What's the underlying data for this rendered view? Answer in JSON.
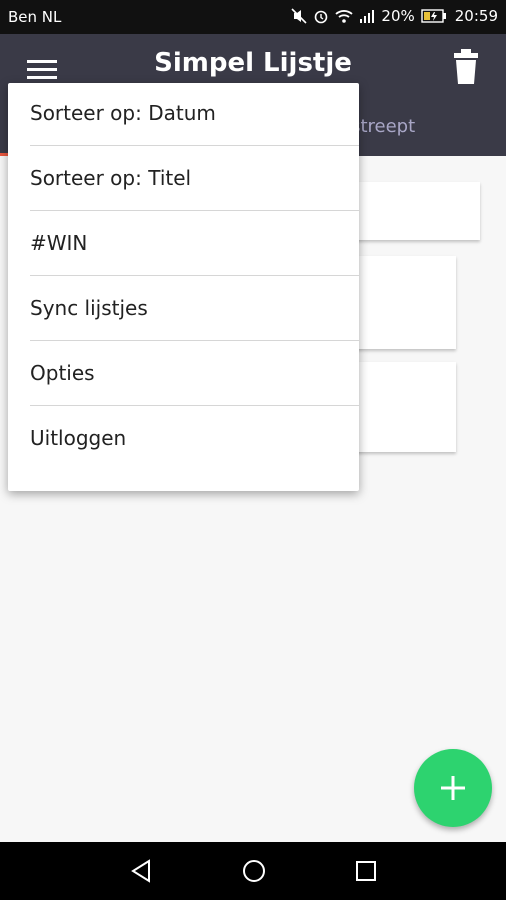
{
  "status_bar": {
    "carrier": "Ben NL",
    "battery": "20%",
    "time": "20:59"
  },
  "app_bar": {
    "title": "Simpel Lijstje"
  },
  "tabs": {
    "visible_label": "estreept"
  },
  "menu": {
    "items": [
      {
        "label": "Sorteer op: Datum"
      },
      {
        "label": "Sorteer op: Titel"
      },
      {
        "label": "#WIN"
      },
      {
        "label": "Sync lijstjes"
      },
      {
        "label": "Opties"
      },
      {
        "label": "Uitloggen"
      }
    ]
  },
  "colors": {
    "app_bar": "#3a3a47",
    "tab_text": "#a8a6c6",
    "tab_indicator": "#e9573f",
    "fab": "#2dd36f",
    "background": "#f7f7f7"
  },
  "icons": {
    "menu": "hamburger-icon",
    "delete": "trash-icon",
    "fab": "plus-icon",
    "nav_back": "back-triangle-icon",
    "nav_home": "home-circle-icon",
    "nav_recent": "recent-square-icon"
  }
}
